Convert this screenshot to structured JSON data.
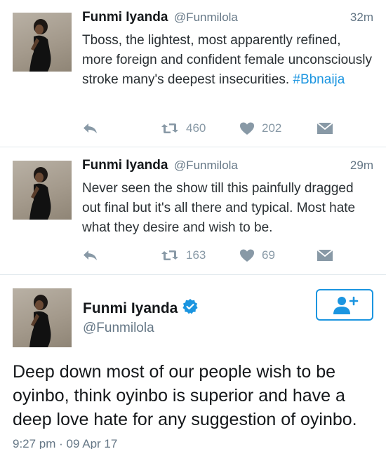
{
  "tweets": [
    {
      "name": "Funmi Iyanda",
      "handle": "@Funmilola",
      "time": "32m",
      "text": "Tboss, the lightest, most apparently refined, more foreign and confident female unconsciously stroke many's deepest insecurities. ",
      "hashtag": "#Bbnaija",
      "retweets": "460",
      "likes": "202"
    },
    {
      "name": "Funmi Iyanda",
      "handle": "@Funmilola",
      "time": "29m",
      "text": "Never seen the show till this painfully dragged out final but it's all there and typical. Most hate what they desire and wish to be.",
      "retweets": "163",
      "likes": "69"
    }
  ],
  "detail": {
    "name": "Funmi Iyanda",
    "handle": "@Funmilola",
    "text": "Deep down most of our people wish to be oyinbo, think oyinbo is superior and have a deep love hate for any suggestion of oyinbo.",
    "timestamp": "9:27 pm · 09 Apr 17"
  },
  "icons": {
    "reply": "reply-icon",
    "retweet": "retweet-icon",
    "like": "heart-icon",
    "dm": "envelope-icon",
    "verified": "verified-badge-icon",
    "follow": "add-user-icon"
  },
  "colors": {
    "accent": "#1b95e0",
    "muted": "#8899a6"
  }
}
